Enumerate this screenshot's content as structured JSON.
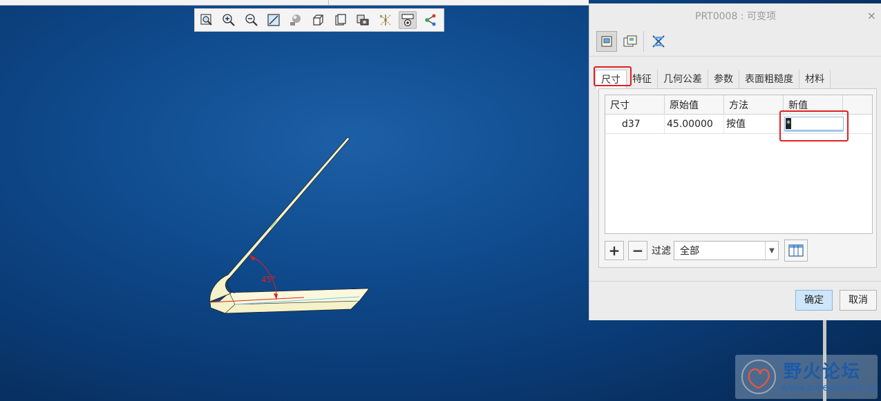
{
  "toolbar": {
    "buttons": [
      {
        "icon": "zoom-fit-icon"
      },
      {
        "icon": "zoom-in-icon"
      },
      {
        "icon": "zoom-out-icon"
      },
      {
        "icon": "reorient-icon"
      },
      {
        "icon": "shading-icon"
      },
      {
        "icon": "view-cube-icon"
      },
      {
        "icon": "saved-views-icon"
      },
      {
        "icon": "camera-icon"
      },
      {
        "icon": "datum-display-icon"
      },
      {
        "icon": "annotation-display-icon"
      },
      {
        "icon": "spin-center-icon"
      }
    ],
    "active_index": 9
  },
  "model": {
    "dimension_label": "45°",
    "colors": {
      "body": "#f4f0c8",
      "dim": "#dd2020",
      "edge": "#1a1a1a"
    }
  },
  "dialog": {
    "title": "PRT0008 : 可变项",
    "close_symbol": "×",
    "top_buttons": [
      {
        "icon": "dimension-mode-icon",
        "active": true
      },
      {
        "icon": "feature-mode-icon",
        "active": false
      },
      {
        "icon": "clear-icon",
        "active": false
      }
    ],
    "tabs": [
      "尺寸",
      "特征",
      "几何公差",
      "参数",
      "表面粗糙度",
      "材料"
    ],
    "active_tab": 0,
    "table": {
      "headers": [
        "尺寸",
        "原始值",
        "方法",
        "新值"
      ],
      "rows": [
        {
          "dimension": "d37",
          "original": "45.00000",
          "method": "按值",
          "new_value": "*"
        }
      ]
    },
    "add_symbol": "+",
    "remove_symbol": "−",
    "filter_label": "过滤",
    "filter_value": "全部",
    "ok_label": "确定",
    "cancel_label": "取消"
  },
  "watermark": {
    "name": "野火论坛",
    "url": "www.proewildfire.cn"
  }
}
